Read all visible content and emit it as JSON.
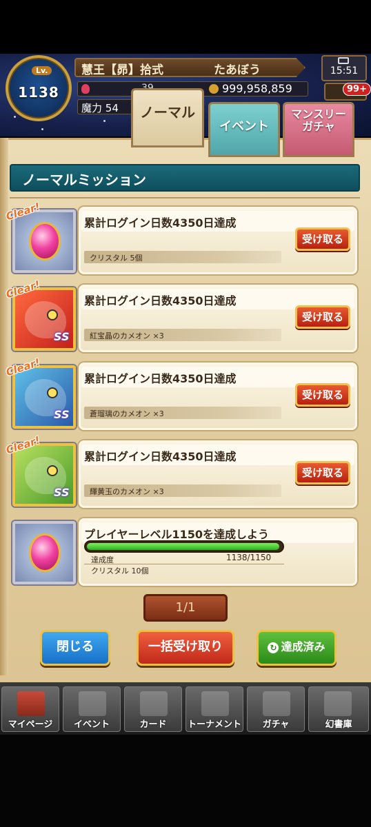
{
  "header": {
    "level_tag": "Lv.",
    "level": "1138",
    "name_left": "慧王【昴】拾式",
    "name_right": "たあぼう",
    "res_mid": "39",
    "gold": "999,958,859",
    "power_label": "魔力",
    "power_value": "54",
    "time": "15:51",
    "notif_badge": "99+"
  },
  "tabs": [
    {
      "label": "ノーマル"
    },
    {
      "label": "イベント"
    },
    {
      "label": "マンスリーガチャ"
    }
  ],
  "section_title": "ノーマルミッション",
  "missions": [
    {
      "clear": "Clear!",
      "title": "累計ログイン日数4350日達成",
      "reward": "クリスタル 5個",
      "button": "受け取る",
      "icon": "crystal-icon"
    },
    {
      "clear": "Clear!",
      "title": "累計ログイン日数4350日達成",
      "reward": "紅宝晶のカメオン ×3",
      "button": "受け取る",
      "icon": "red-chameleon-icon"
    },
    {
      "clear": "Clear!",
      "title": "累計ログイン日数4350日達成",
      "reward": "蒼瑠璃のカメオン ×3",
      "button": "受け取る",
      "icon": "blue-chameleon-icon"
    },
    {
      "clear": "Clear!",
      "title": "累計ログイン日数4350日達成",
      "reward": "輝黄玉のカメオン ×3",
      "button": "受け取る",
      "icon": "green-chameleon-icon"
    },
    {
      "title": "プレイヤーレベル1150を達成しよう",
      "progress_label": "達成度",
      "progress_value": "1138/1150",
      "progress_fraction": 0.9896,
      "reward": "クリスタル 10個",
      "icon": "crystal-icon"
    }
  ],
  "pager": "1/1",
  "buttons": {
    "close": "閉じる",
    "receive_all": "一括受け取り",
    "completed": "達成済み"
  },
  "nav": [
    {
      "label": "マイページ"
    },
    {
      "label": "イベント"
    },
    {
      "label": "カード"
    },
    {
      "label": "トーナメント"
    },
    {
      "label": "ガチャ"
    },
    {
      "label": "幻書庫"
    }
  ],
  "colors": {
    "section_header": "#1b6a7a",
    "receive_button": "#d8401e",
    "close_button": "#2f8ce0",
    "receive_all_button": "#e04430",
    "completed_button": "#44a62c",
    "clear_tag": "#f07020"
  }
}
